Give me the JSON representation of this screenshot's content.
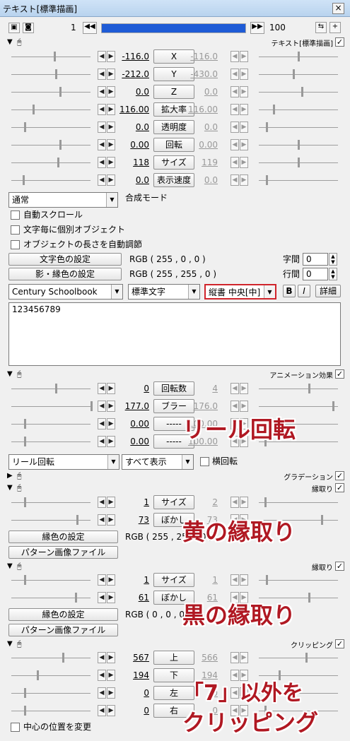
{
  "window": {
    "title": "テキスト[標準描画]",
    "close": "×"
  },
  "toolbar": {
    "start_frame": "1",
    "end_frame": "100",
    "progress": 1.0
  },
  "text_section": {
    "label": "テキスト[標準描画]",
    "params": [
      {
        "left": "-116.0",
        "button": "X",
        "right": "-116.0"
      },
      {
        "left": "-212.0",
        "button": "Y",
        "right": "-430.0"
      },
      {
        "left": "0.0",
        "button": "Z",
        "right": "0.0"
      },
      {
        "left": "116.00",
        "button": "拡大率",
        "right": "116.00"
      },
      {
        "left": "0.0",
        "button": "透明度",
        "right": "0.0"
      },
      {
        "left": "0.00",
        "button": "回転",
        "right": "0.00"
      },
      {
        "left": "118",
        "button": "サイズ",
        "right": "119"
      },
      {
        "left": "0.0",
        "button": "表示速度",
        "right": "0.0"
      }
    ],
    "blend_value": "通常",
    "blend_label": "合成モード",
    "checks": [
      "自動スクロール",
      "文字毎に個別オブジェクト",
      "オブジェクトの長さを自動調節"
    ],
    "color_btn": "文字色の設定",
    "color_val": "RGB ( 255 , 0 , 0 )",
    "shadow_btn": "影・縁色の設定",
    "shadow_val": "RGB ( 255 , 255 , 0 )",
    "spacing_label": "字間",
    "spacing_val": "0",
    "line_label": "行間",
    "line_val": "0",
    "font": "Century Schoolbook",
    "style": "標準文字",
    "align": "縦書 中央[中]",
    "bold": "B",
    "italic": "I",
    "detail": "詳細",
    "text": "123456789"
  },
  "anim_section": {
    "label": "アニメーション効果",
    "params": [
      {
        "left": "0",
        "button": "回転数",
        "right": "4"
      },
      {
        "left": "177.0",
        "button": "ブラー",
        "right": "176.0"
      },
      {
        "left": "0.00",
        "button": "-----",
        "right": "100.00"
      },
      {
        "left": "0.00",
        "button": "-----",
        "right": "100.00"
      }
    ],
    "type": "リール回転",
    "mode": "すべて表示",
    "horiz": "横回転"
  },
  "gradient_label": "グラデーション",
  "border1": {
    "label": "縁取り",
    "params": [
      {
        "left": "1",
        "button": "サイズ",
        "right": "2"
      },
      {
        "left": "73",
        "button": "ぼかし",
        "right": "73"
      }
    ],
    "color_btn": "縁色の設定",
    "color_val": "RGB ( 255 , 255 , 0 )",
    "pattern": "パターン画像ファイル"
  },
  "border2": {
    "label": "縁取り",
    "params": [
      {
        "left": "1",
        "button": "サイズ",
        "right": "1"
      },
      {
        "left": "61",
        "button": "ぼかし",
        "right": "61"
      }
    ],
    "color_btn": "縁色の設定",
    "color_val": "RGB ( 0 , 0 , 0 )",
    "pattern": "パターン画像ファイル"
  },
  "clip_section": {
    "label": "クリッピング",
    "params": [
      {
        "left": "567",
        "button": "上",
        "right": "566"
      },
      {
        "left": "194",
        "button": "下",
        "right": "194"
      },
      {
        "left": "0",
        "button": "左",
        "right": "0"
      },
      {
        "left": "0",
        "button": "右",
        "right": "0"
      }
    ],
    "center": "中心の位置を変更"
  },
  "annotations": {
    "reel": "リール回転",
    "yellow": "黄の縁取り",
    "black": "黒の縁取り",
    "clip1": "「7」以外を",
    "clip2": "クリッピング"
  }
}
